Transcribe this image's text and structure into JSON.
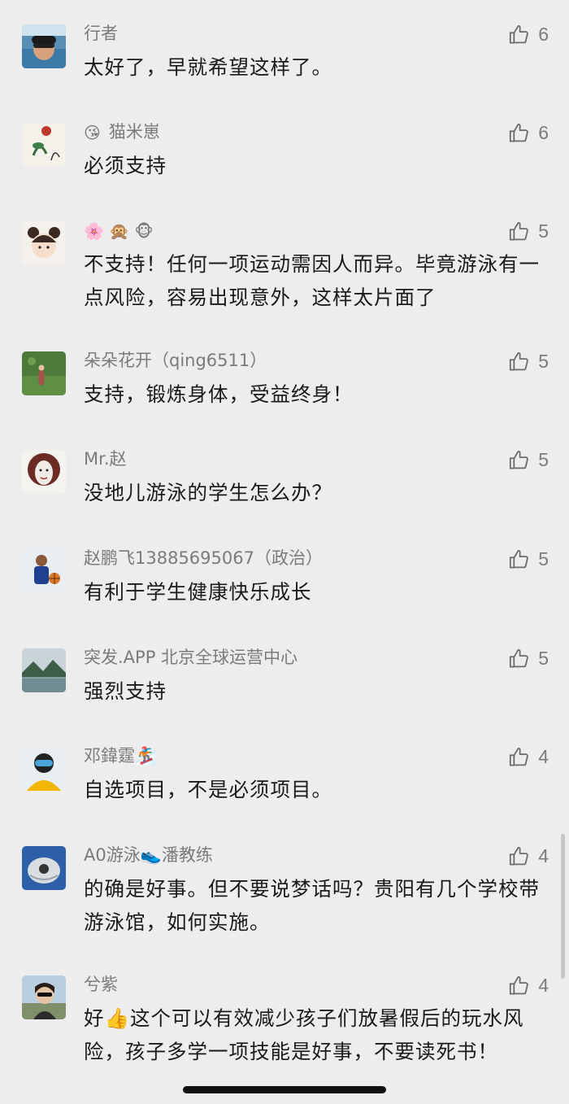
{
  "comments": [
    {
      "name": "行者",
      "emoji": "",
      "text": "太好了，早就希望这样了。",
      "likes": "6",
      "avatar_icon": "swimmer-avatar-icon"
    },
    {
      "name": "猫米崽",
      "emoji": "😘",
      "text": "必须支持",
      "likes": "6",
      "avatar_icon": "lotus-painting-avatar-icon"
    },
    {
      "name": "",
      "emoji": "🌸 🙊 🐵",
      "text": "不支持！任何一项运动需因人而异。毕竟游泳有一点风险，容易出现意外，这样太片面了",
      "likes": "5",
      "avatar_icon": "cartoon-girl-avatar-icon"
    },
    {
      "name": "朵朵花开（qing6511）",
      "emoji": "",
      "text": "支持，锻炼身体，受益终身！",
      "likes": "5",
      "avatar_icon": "field-photo-avatar-icon"
    },
    {
      "name": "Mr.赵",
      "emoji": "",
      "text": "没地儿游泳的学生怎么办？",
      "likes": "5",
      "avatar_icon": "face-art-avatar-icon"
    },
    {
      "name": "赵鹏飞13885695067（政治）",
      "emoji": "",
      "text": "有利于学生健康快乐成长",
      "likes": "5",
      "avatar_icon": "basketball-player-avatar-icon"
    },
    {
      "name": "突发.APP 北京全球运营中心",
      "emoji": "",
      "text": "强烈支持",
      "likes": "5",
      "avatar_icon": "lake-landscape-avatar-icon"
    },
    {
      "name": "邓鍏霆🏂",
      "emoji": "",
      "text": "自选项目，不是必须项目。",
      "likes": "4",
      "avatar_icon": "snowboarder-avatar-icon"
    },
    {
      "name": "A0游泳👟潘教练",
      "emoji": "",
      "text": "的确是好事。但不要说梦话吗？贵阳有几个学校带游泳馆，如何实施。",
      "likes": "4",
      "avatar_icon": "swim-cap-avatar-icon"
    },
    {
      "name": "兮紫",
      "emoji": "",
      "text": "好👍这个可以有效减少孩子们放暑假后的玩水风险，孩子多学一项技能是好事，不要读死书！",
      "likes": "4",
      "avatar_icon": "woman-sunglasses-avatar-icon"
    }
  ],
  "colors": {
    "background": "#ededed",
    "name": "#7b7b7b",
    "text": "#1a1a1a",
    "like_icon": "#6b6b6b"
  },
  "icons": {
    "like": "thumbs-up-icon"
  }
}
